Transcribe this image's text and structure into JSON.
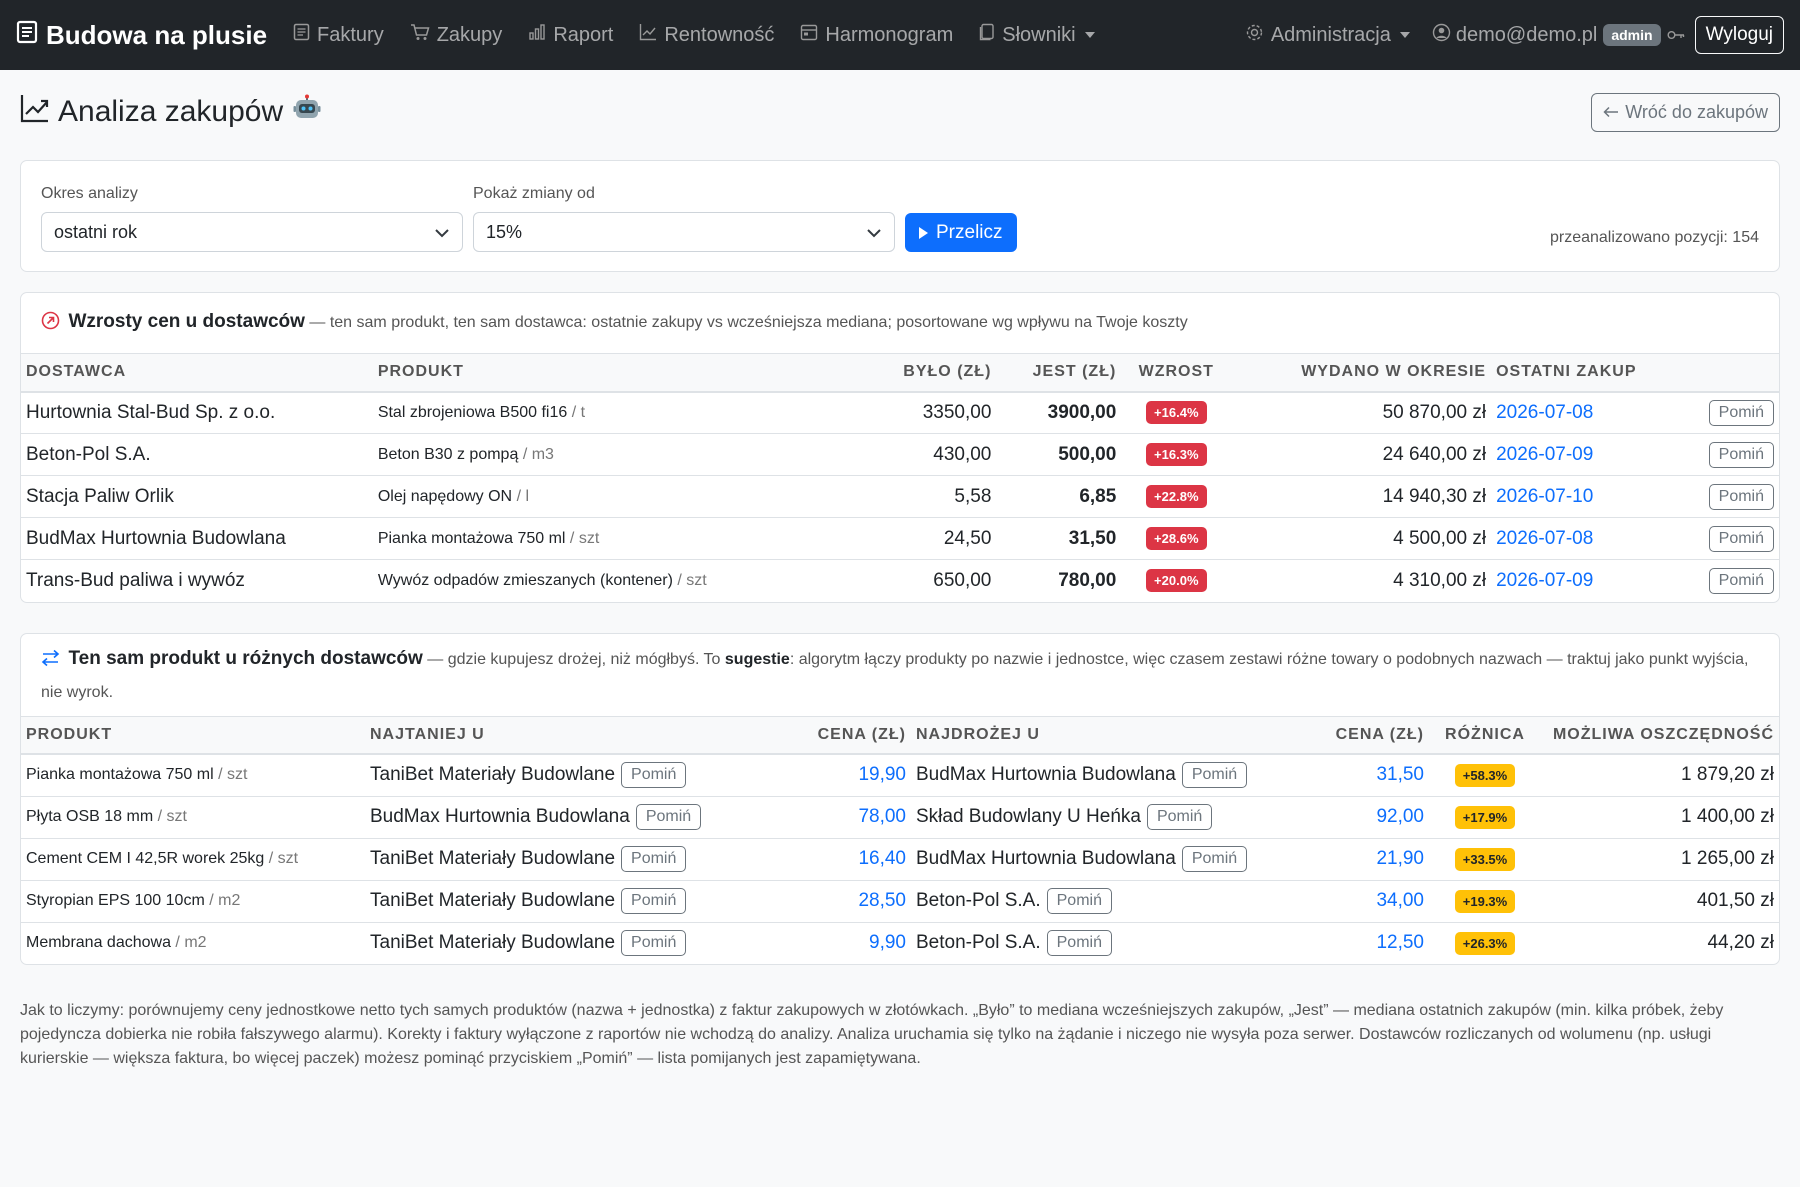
{
  "navbar": {
    "brand": "Budowa na plusie",
    "items": [
      {
        "label": "Faktury",
        "icon": "invoice-icon"
      },
      {
        "label": "Zakupy",
        "icon": "cart-icon"
      },
      {
        "label": "Raport",
        "icon": "bar-chart-icon"
      },
      {
        "label": "Rentowność",
        "icon": "trend-icon"
      },
      {
        "label": "Harmonogram",
        "icon": "calendar-icon"
      },
      {
        "label": "Słowniki",
        "icon": "dictionary-icon"
      }
    ],
    "admin_label": "Administracja",
    "user_email": "demo@demo.pl",
    "role": "admin",
    "logout_label": "Wyloguj"
  },
  "page": {
    "title": "Analiza zakupów",
    "back_label": "Wróć do zakupów"
  },
  "filters": {
    "period_label": "Okres analizy",
    "period_value": "ostatni rok",
    "threshold_label": "Pokaż zmiany od",
    "threshold_value": "15%",
    "run_label": "Przelicz",
    "analyzed_text": "przeanalizowano pozycji: 154"
  },
  "increases": {
    "title": "Wzrosty cen u dostawców",
    "subtitle": "— ten sam produkt, ten sam dostawca: ostatnie zakupy vs wcześniejsza mediana; posortowane wg wpływu na Twoje koszty",
    "headers": [
      "DOSTAWCA",
      "PRODUKT",
      "BYŁO (ZŁ)",
      "JEST (ZŁ)",
      "WZROST",
      "WYDANO W OKRESIE",
      "OSTATNI ZAKUP"
    ],
    "skip_label": "Pomiń",
    "rows": [
      {
        "supplier": "Hurtownia Stal-Bud Sp. z o.o.",
        "product": "Stal zbrojeniowa B500 fi16",
        "unit": "/ t",
        "was": "3350,00",
        "now": "3900,00",
        "change": "+16.4%",
        "spent": "50 870,00 zł",
        "last": "2026-07-08"
      },
      {
        "supplier": "Beton-Pol S.A.",
        "product": "Beton B30 z pompą",
        "unit": "/ m3",
        "was": "430,00",
        "now": "500,00",
        "change": "+16.3%",
        "spent": "24 640,00 zł",
        "last": "2026-07-09"
      },
      {
        "supplier": "Stacja Paliw Orlik",
        "product": "Olej napędowy ON",
        "unit": "/ l",
        "was": "5,58",
        "now": "6,85",
        "change": "+22.8%",
        "spent": "14 940,30 zł",
        "last": "2026-07-10"
      },
      {
        "supplier": "BudMax Hurtownia Budowlana",
        "product": "Pianka montażowa 750 ml",
        "unit": "/ szt",
        "was": "24,50",
        "now": "31,50",
        "change": "+28.6%",
        "spent": "4 500,00 zł",
        "last": "2026-07-08"
      },
      {
        "supplier": "Trans-Bud paliwa i wywóz",
        "product": "Wywóz odpadów zmieszanych (kontener)",
        "unit": "/ szt",
        "was": "650,00",
        "now": "780,00",
        "change": "+20.0%",
        "spent": "4 310,00 zł",
        "last": "2026-07-09"
      }
    ]
  },
  "compare": {
    "title": "Ten sam produkt u różnych dostawców",
    "subtitle_pre": "— gdzie kupujesz drożej, niż mógłbyś. To ",
    "subtitle_bold": "sugestie",
    "subtitle_post": ": algorytm łączy produkty po nazwie i jednostce, więc czasem zestawi różne towary o podobnych nazwach — traktuj jako punkt wyjścia, nie wyrok.",
    "headers": [
      "PRODUKT",
      "NAJTANIEJ U",
      "CENA (ZŁ)",
      "NAJDROŻEJ U",
      "CENA (ZŁ)",
      "RÓŻNICA",
      "MOŻLIWA OSZCZĘDNOŚĆ"
    ],
    "skip_label": "Pomiń",
    "rows": [
      {
        "product": "Pianka montażowa 750 ml",
        "unit": "/ szt",
        "cheap": "TaniBet Materiały Budowlane",
        "cheap_price": "19,90",
        "exp": "BudMax Hurtownia Budowlana",
        "exp_price": "31,50",
        "diff": "+58.3%",
        "saving": "1 879,20 zł"
      },
      {
        "product": "Płyta OSB 18 mm",
        "unit": "/ szt",
        "cheap": "BudMax Hurtownia Budowlana",
        "cheap_price": "78,00",
        "exp": "Skład Budowlany U Heńka",
        "exp_price": "92,00",
        "diff": "+17.9%",
        "saving": "1 400,00 zł"
      },
      {
        "product": "Cement CEM I 42,5R worek 25kg",
        "unit": "/ szt",
        "cheap": "TaniBet Materiały Budowlane",
        "cheap_price": "16,40",
        "exp": "BudMax Hurtownia Budowlana",
        "exp_price": "21,90",
        "diff": "+33.5%",
        "saving": "1 265,00 zł"
      },
      {
        "product": "Styropian EPS 100 10cm",
        "unit": "/ m2",
        "cheap": "TaniBet Materiały Budowlane",
        "cheap_price": "28,50",
        "exp": "Beton-Pol S.A.",
        "exp_price": "34,00",
        "diff": "+19.3%",
        "saving": "401,50 zł"
      },
      {
        "product": "Membrana dachowa",
        "unit": "/ m2",
        "cheap": "TaniBet Materiały Budowlane",
        "cheap_price": "9,90",
        "exp": "Beton-Pol S.A.",
        "exp_price": "12,50",
        "diff": "+26.3%",
        "saving": "44,20 zł"
      }
    ]
  },
  "footnote": "Jak to liczymy: porównujemy ceny jednostkowe netto tych samych produktów (nazwa + jednostka) z faktur zakupowych w złotówkach. „Było” to mediana wcześniejszych zakupów, „Jest” — mediana ostatnich zakupów (min. kilka próbek, żeby pojedyncza dobierka nie robiła fałszywego alarmu). Korekty i faktury wyłączone z raportów nie wchodzą do analizy. Analiza uruchamia się tylko na żądanie i niczego nie wysyła poza serwer. Dostawców rozliczanych od wolumenu (np. usługi kurierskie — większa faktura, bo więcej paczek) możesz pominąć przyciskiem „Pomiń” — lista pomijanych jest zapamiętywana.",
  "colors": {
    "primary": "#0d6efd",
    "danger": "#dc3545",
    "warning": "#ffc107",
    "navbar": "#212529"
  }
}
